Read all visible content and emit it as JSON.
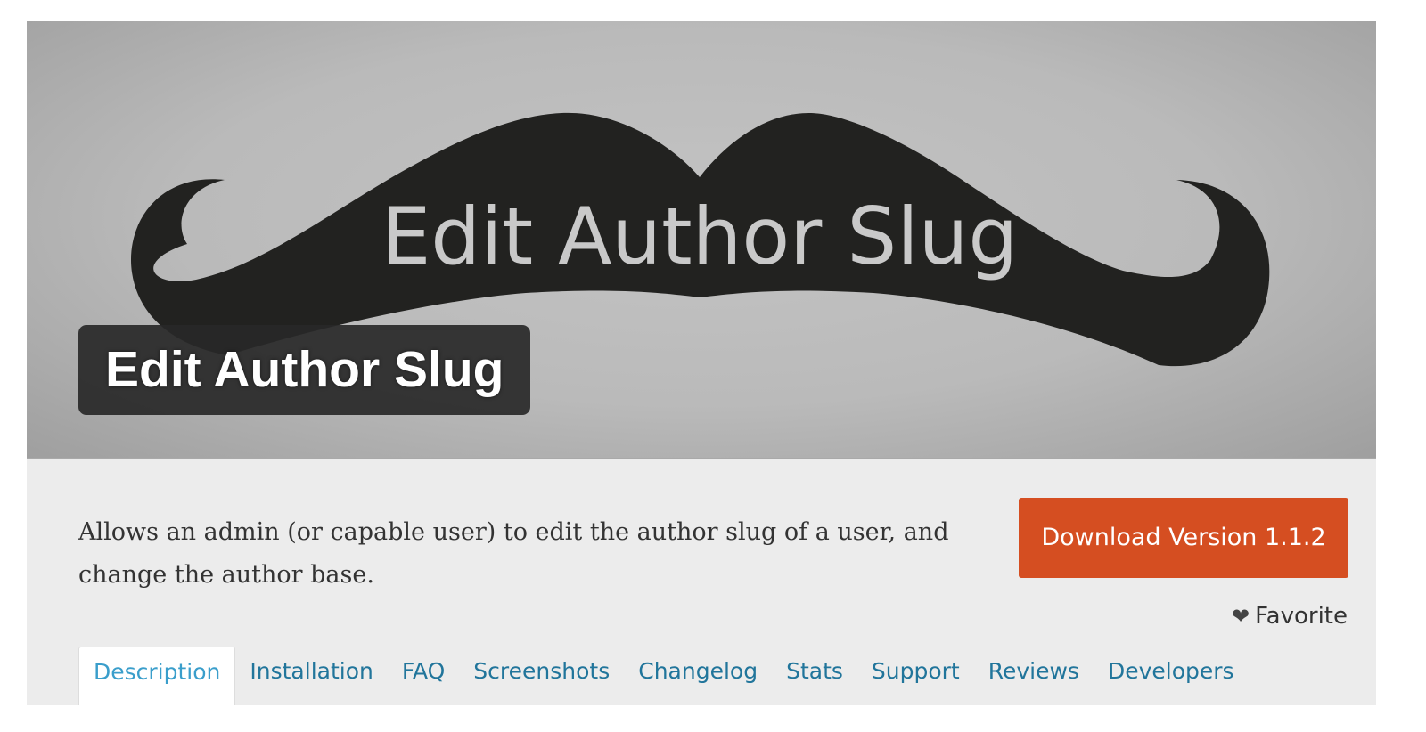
{
  "banner": {
    "artwork_text": "Edit Author Slug",
    "plugin_title": "Edit Author Slug"
  },
  "summary": {
    "text": "Allows an admin (or capable user) to edit the author slug of a user, and change the author base."
  },
  "download": {
    "label": "Download Version 1.1.2"
  },
  "favorite": {
    "icon": "heart-icon",
    "label": "Favorite"
  },
  "tabs": [
    {
      "label": "Description",
      "active": true
    },
    {
      "label": "Installation"
    },
    {
      "label": "FAQ"
    },
    {
      "label": "Screenshots"
    },
    {
      "label": "Changelog"
    },
    {
      "label": "Stats"
    },
    {
      "label": "Support"
    },
    {
      "label": "Reviews"
    },
    {
      "label": "Developers"
    }
  ],
  "colors": {
    "download_button": "#d54e21",
    "tab_link": "#21759b",
    "tab_active": "#3a9ecb",
    "mustache": "#222220"
  }
}
